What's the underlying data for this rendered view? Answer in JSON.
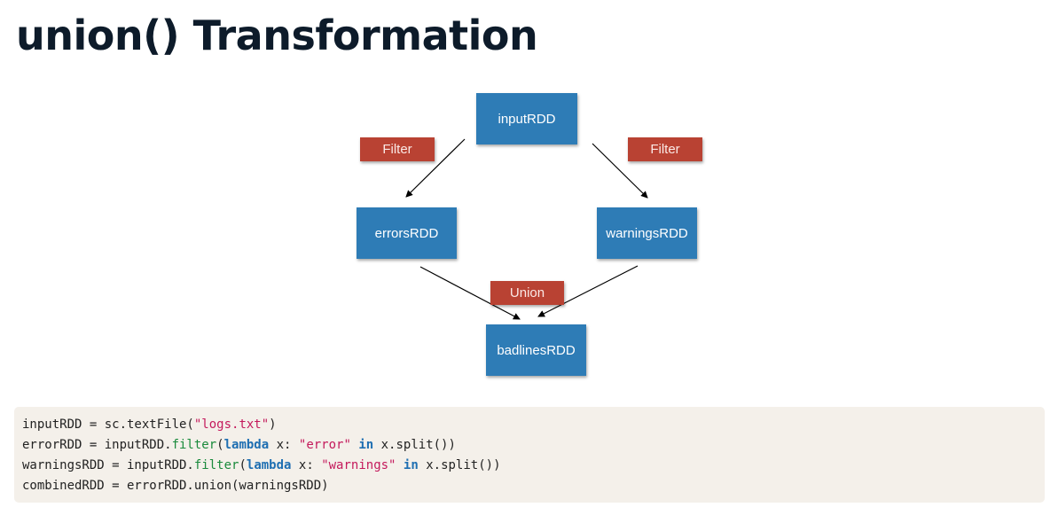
{
  "title": "union() Transformation",
  "diagram": {
    "nodes": {
      "input": "inputRDD",
      "errors": "errorsRDD",
      "warnings": "warningsRDD",
      "badlines": "badlinesRDD"
    },
    "operations": {
      "filter_left": "Filter",
      "filter_right": "Filter",
      "union": "Union"
    },
    "colors": {
      "node": "#2e7cb6",
      "operation": "#b94233",
      "arrow": "#000000"
    }
  },
  "code": {
    "background": "#f4f0ea",
    "lines": [
      [
        {
          "t": "inputRDD = sc.textFile(",
          "c": ""
        },
        {
          "t": "\"logs.txt\"",
          "c": "str"
        },
        {
          "t": ")",
          "c": ""
        }
      ],
      [
        {
          "t": "errorRDD = inputRDD.",
          "c": ""
        },
        {
          "t": "filter",
          "c": "fn"
        },
        {
          "t": "(",
          "c": ""
        },
        {
          "t": "lambda",
          "c": "kw"
        },
        {
          "t": " x: ",
          "c": ""
        },
        {
          "t": "\"error\"",
          "c": "str"
        },
        {
          "t": " ",
          "c": ""
        },
        {
          "t": "in",
          "c": "kw"
        },
        {
          "t": " x.split())",
          "c": ""
        }
      ],
      [
        {
          "t": "warningsRDD = inputRDD.",
          "c": ""
        },
        {
          "t": "filter",
          "c": "fn"
        },
        {
          "t": "(",
          "c": ""
        },
        {
          "t": "lambda",
          "c": "kw"
        },
        {
          "t": " x: ",
          "c": ""
        },
        {
          "t": "\"warnings\"",
          "c": "str"
        },
        {
          "t": " ",
          "c": ""
        },
        {
          "t": "in",
          "c": "kw"
        },
        {
          "t": " x.split())",
          "c": ""
        }
      ],
      [
        {
          "t": "combinedRDD = errorRDD.union(warningsRDD)",
          "c": ""
        }
      ]
    ]
  }
}
